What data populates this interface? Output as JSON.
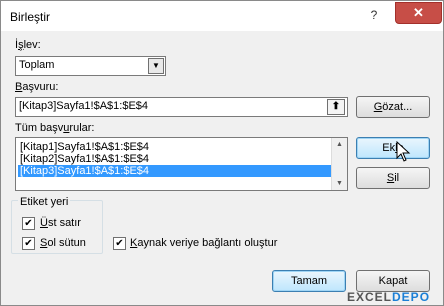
{
  "window": {
    "title": "Birleştir",
    "help_label": "?",
    "close_label": "✕"
  },
  "function": {
    "label_pre": "İ",
    "label_mnemonic": "ş",
    "label_post": "lev:",
    "selected": "Toplam"
  },
  "reference": {
    "label_pre": "",
    "label_mnemonic": "B",
    "label_post": "aşvuru:",
    "value": "[Kitap3]Sayfa1!$A$1:$E$4",
    "browse_pre": "",
    "browse_mnemonic": "G",
    "browse_post": "özat..."
  },
  "all_references": {
    "label_pre": "Tüm başv",
    "label_mnemonic": "u",
    "label_post": "rular:",
    "items": [
      "[Kitap1]Sayfa1!$A$1:$E$4",
      "[Kitap2]Sayfa1!$A$1:$E$4",
      "[Kitap3]Sayfa1!$A$1:$E$4"
    ],
    "selected_index": 2
  },
  "buttons": {
    "add_pre": "Ek",
    "add_mnemonic": "l",
    "add_post": "e",
    "delete_pre": "",
    "delete_mnemonic": "S",
    "delete_post": "il",
    "ok": "Tamam",
    "cancel": "Kapat"
  },
  "labels_group": {
    "title": "Etiket yeri",
    "top_row_pre": "",
    "top_row_mnemonic": "Ü",
    "top_row_post": "st satır",
    "top_row_checked": true,
    "left_col_pre": "",
    "left_col_mnemonic": "S",
    "left_col_post": "ol sütun",
    "left_col_checked": true
  },
  "link": {
    "label_pre": "",
    "label_mnemonic": "K",
    "label_post": "aynak veriye bağlantı oluştur",
    "checked": true
  },
  "watermark": {
    "part1": "EXCEL",
    "part2": "DEPO"
  }
}
